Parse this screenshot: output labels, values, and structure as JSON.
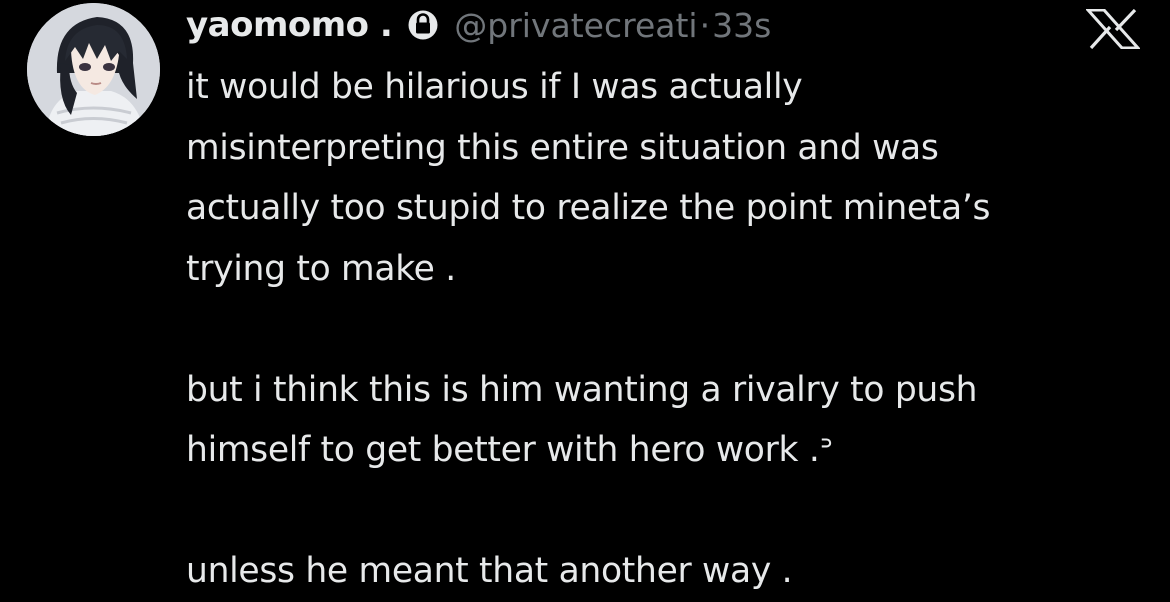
{
  "tweet": {
    "display_name": "yaomomo .",
    "handle": "@privatecreati",
    "separator": "·",
    "time": "33s",
    "lock_icon": "lock-icon",
    "logo_icon": "x-logo-icon",
    "avatar_icon": "anime-avatar",
    "paragraphs": [
      [
        "it would be hilarious if I was actually",
        "misinterpreting this entire situation and was",
        "actually too stupid to realize the point mineta’s",
        "trying to make ."
      ],
      [
        "but i think this is him wanting a rivalry to push",
        "himself to get better with hero work .ᐣ"
      ],
      [
        "unless he meant that another way ."
      ]
    ]
  },
  "colors": {
    "background": "#000000",
    "text_primary": "#e7e9ea",
    "text_secondary": "#71767b"
  }
}
